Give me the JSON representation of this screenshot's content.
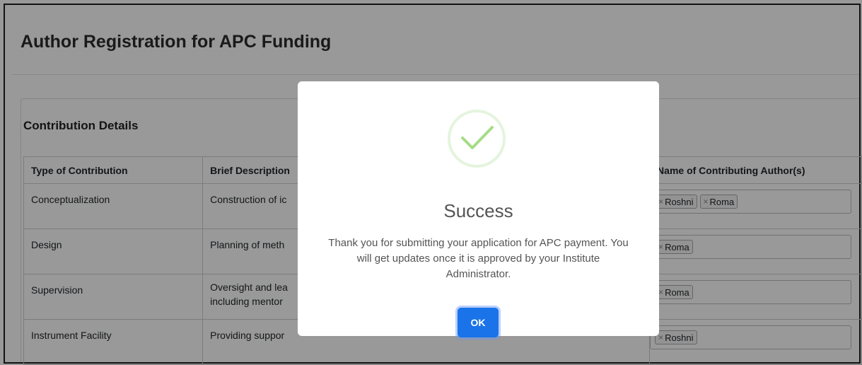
{
  "page": {
    "title": "Author Registration for APC Funding"
  },
  "section": {
    "title": "Contribution Details"
  },
  "table": {
    "headers": [
      "Type of Contribution",
      "Brief Description",
      "Name of Contributing Author(s)"
    ],
    "rows": [
      {
        "type": "Conceptualization",
        "description": "Construction of ic",
        "authors": [
          "Roshni",
          "Roma"
        ]
      },
      {
        "type": "Design",
        "description": "Planning of meth",
        "authors": [
          "Roma"
        ]
      },
      {
        "type": "Supervision",
        "description": "Oversight and lea",
        "description2": "including mentor",
        "authors": [
          "Roma"
        ]
      },
      {
        "type": "Instrument Facility",
        "description": "Providing suppor",
        "authors": [
          "Roshni"
        ]
      }
    ]
  },
  "modal": {
    "title": "Success",
    "message": "Thank you for submitting your application for APC payment. You will get updates once it is approved by your Institute Administrator.",
    "ok_label": "OK",
    "icon": "check-circle-icon"
  },
  "colors": {
    "accent": "#1a73e8",
    "success": "#a5dc86"
  }
}
